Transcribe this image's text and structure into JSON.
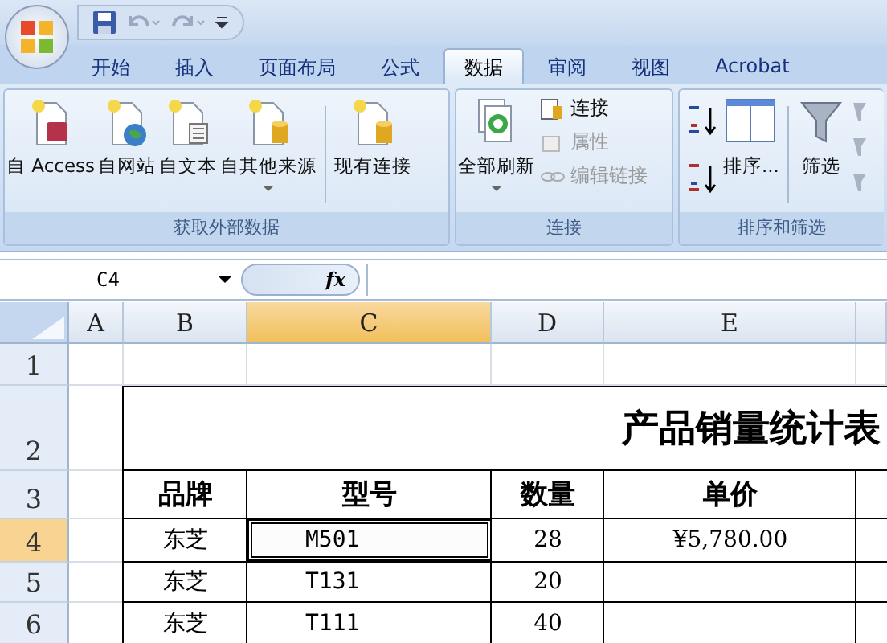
{
  "tabs": [
    {
      "label": "开始",
      "selected": false
    },
    {
      "label": "插入",
      "selected": false
    },
    {
      "label": "页面布局",
      "selected": false
    },
    {
      "label": "公式",
      "selected": false
    },
    {
      "label": "数据",
      "selected": true
    },
    {
      "label": "审阅",
      "selected": false
    },
    {
      "label": "视图",
      "selected": false
    },
    {
      "label": "Acrobat",
      "selected": false
    }
  ],
  "ribbon_groups": [
    {
      "title": "获取外部数据",
      "items": [
        {
          "kind": "large",
          "label": "自 Access",
          "dropdown": false
        },
        {
          "kind": "large",
          "label": "自网站",
          "dropdown": false
        },
        {
          "kind": "large",
          "label": "自文本",
          "dropdown": false
        },
        {
          "kind": "large",
          "label": "自其他来源",
          "dropdown": true
        },
        {
          "kind": "separator"
        },
        {
          "kind": "large",
          "label": "现有连接",
          "dropdown": false
        }
      ]
    },
    {
      "title": "连接",
      "items": [
        {
          "kind": "large",
          "label": "全部刷新",
          "dropdown": true
        },
        {
          "kind": "stack",
          "items": [
            {
              "label": "连接",
              "disabled": false
            },
            {
              "label": "属性",
              "disabled": true
            },
            {
              "label": "编辑链接",
              "disabled": true
            }
          ]
        }
      ]
    },
    {
      "title": "排序和筛选",
      "items": [
        {
          "kind": "sortpair"
        },
        {
          "kind": "large",
          "label": "排序...",
          "dropdown": false
        },
        {
          "kind": "separator"
        },
        {
          "kind": "large",
          "label": "筛选",
          "dropdown": false
        },
        {
          "kind": "filterstack"
        }
      ]
    }
  ],
  "name_box": "C4",
  "fx": "fx",
  "columns": [
    {
      "label": "A",
      "selected": false
    },
    {
      "label": "B",
      "selected": false
    },
    {
      "label": "C",
      "selected": true
    },
    {
      "label": "D",
      "selected": false
    },
    {
      "label": "E",
      "selected": false
    }
  ],
  "rows": [
    {
      "label": "1",
      "selected": false,
      "kind": "blank"
    },
    {
      "label": "2",
      "selected": false,
      "kind": "title",
      "title": "产品销量统计表"
    },
    {
      "label": "3",
      "selected": false,
      "kind": "header",
      "cells": [
        {
          "text": "品牌"
        },
        {
          "text": "型号"
        },
        {
          "text": "数量"
        },
        {
          "text": "单价"
        }
      ]
    },
    {
      "label": "4",
      "selected": true,
      "kind": "data",
      "cells": [
        {
          "text": "东芝",
          "active": false
        },
        {
          "text": "M501",
          "active": true
        },
        {
          "text": "28",
          "active": false
        },
        {
          "text": "¥5,780.00",
          "active": false
        }
      ]
    },
    {
      "label": "5",
      "selected": false,
      "kind": "data",
      "cells": [
        {
          "text": "东芝",
          "active": false
        },
        {
          "text": "T131",
          "active": false
        },
        {
          "text": "20",
          "active": false
        },
        {
          "active": false
        }
      ]
    },
    {
      "label": "6",
      "selected": false,
      "kind": "data",
      "cells": [
        {
          "text": "东芝",
          "active": false
        },
        {
          "text": "T111",
          "active": false
        },
        {
          "text": "40",
          "active": false
        },
        {
          "active": false
        }
      ]
    }
  ]
}
